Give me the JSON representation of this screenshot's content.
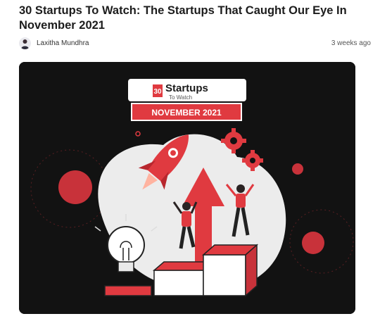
{
  "article": {
    "title": "30 Startups To Watch: The Startups That Caught Our Eye In November 2021",
    "author": "Laxitha Mundhra",
    "time_ago": "3 weeks ago"
  },
  "hero": {
    "logo_number": "30",
    "logo_text": "Startups",
    "logo_subtext": "To Watch",
    "banner_text": "NOVEMBER 2021"
  },
  "colors": {
    "accent_red": "#e03a40",
    "dark_bg": "#121212"
  },
  "icons": [
    "rocket-icon",
    "gear-icon",
    "light-bulb-icon"
  ]
}
